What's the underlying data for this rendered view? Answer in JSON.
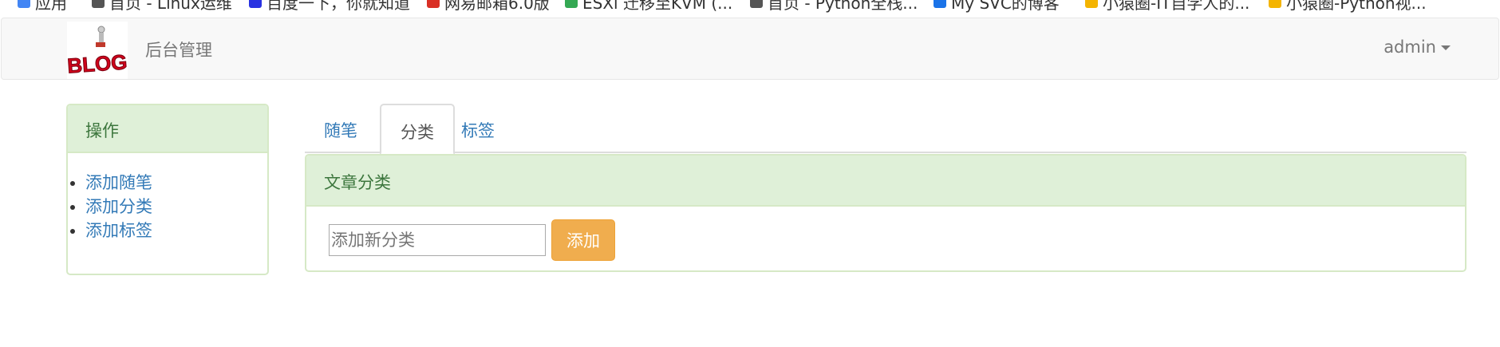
{
  "bookmarks": [
    {
      "label": "应用",
      "color": "#4285f4"
    },
    {
      "label": "首页 - Linux运维",
      "color": "#555555"
    },
    {
      "label": "百度一下，你就知道",
      "color": "#2932e1"
    },
    {
      "label": "网易邮箱6.0版",
      "color": "#d93025"
    },
    {
      "label": "ESXi 迁移至KVM (...",
      "color": "#34a853"
    },
    {
      "label": "首页 - Python全栈...",
      "color": "#555555"
    },
    {
      "label": "My SVC的博客",
      "color": "#1a73e8"
    },
    {
      "label": "小猿圈-IT自学人的...",
      "color": "#f4b400"
    },
    {
      "label": "小猿圈-Python视...",
      "color": "#f4b400"
    }
  ],
  "navbar": {
    "logo_text": "BLOG",
    "brand": "后台管理",
    "user": "admin"
  },
  "sidebar": {
    "title": "操作",
    "items": [
      {
        "label": "添加随笔"
      },
      {
        "label": "添加分类"
      },
      {
        "label": "添加标签"
      }
    ]
  },
  "tabs": [
    {
      "label": "随笔",
      "active": false
    },
    {
      "label": "分类",
      "active": true
    },
    {
      "label": "标签",
      "active": false
    }
  ],
  "main": {
    "panel_title": "文章分类",
    "input_placeholder": "添加新分类",
    "input_value": "",
    "add_button": "添加"
  },
  "colors": {
    "panel_header_bg": "#dff0d8",
    "panel_border": "#d6e9c6",
    "panel_title_text": "#3c763d",
    "link": "#337ab7",
    "warning_button": "#f0ad4e"
  }
}
